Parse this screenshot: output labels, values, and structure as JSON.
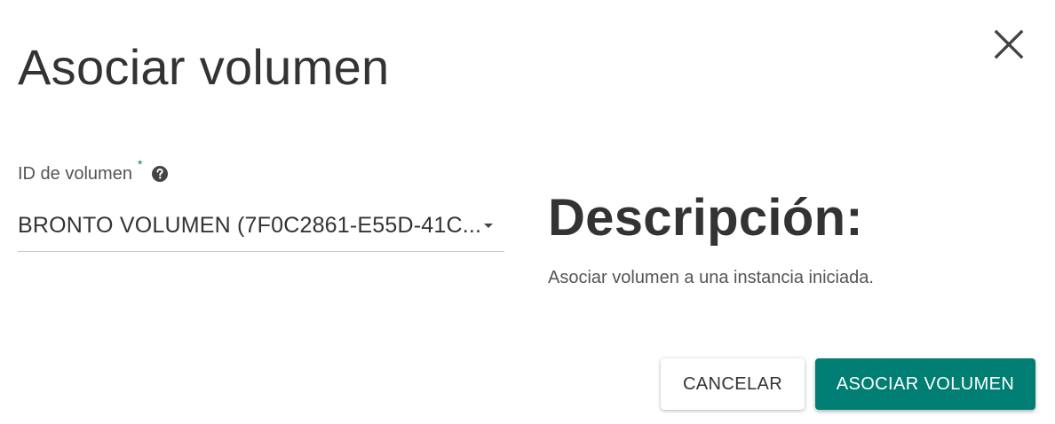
{
  "dialog": {
    "title": "Asociar volumen",
    "close_icon": "close-icon"
  },
  "form": {
    "volume_field": {
      "label": "ID de volumen",
      "required_mark": "*",
      "help_icon": "question-circle-icon",
      "selected_value": "BRONTO VOLUMEN (7F0C2861-E55D-41C...",
      "caret_icon": "chevron-down-icon"
    }
  },
  "description": {
    "title": "Descripción:",
    "text": "Asociar volumen a una instancia iniciada."
  },
  "actions": {
    "cancel_label": "CANCELAR",
    "submit_label": "ASOCIAR VOLUMEN"
  },
  "colors": {
    "accent": "#017e73",
    "text": "#333333"
  }
}
